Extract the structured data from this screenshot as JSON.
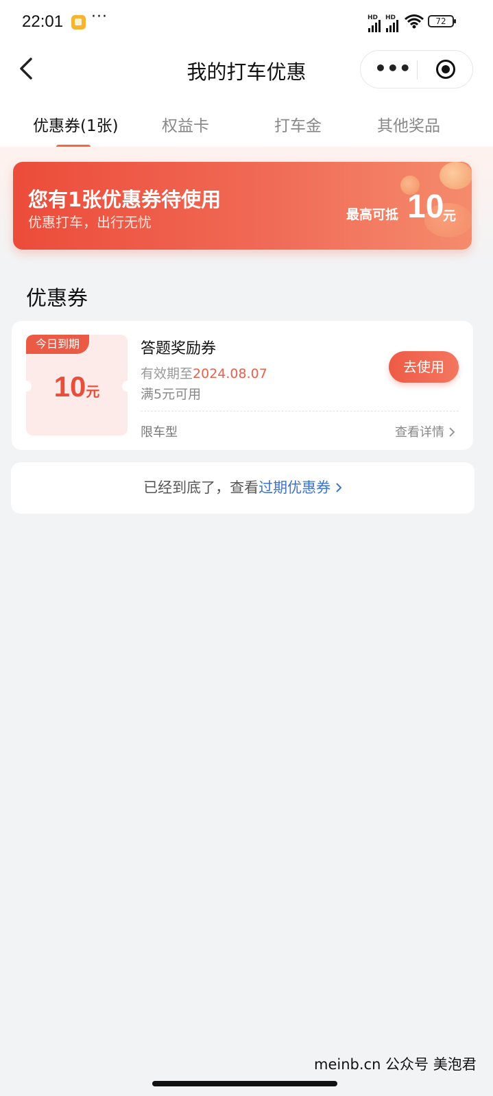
{
  "status_bar": {
    "time": "22:01",
    "more": "···",
    "battery": "72"
  },
  "header": {
    "title": "我的打车优惠",
    "menu_dots": "•••"
  },
  "tabs": [
    {
      "label": "优惠券(1张)",
      "active": true
    },
    {
      "label": "权益卡",
      "active": false
    },
    {
      "label": "打车金",
      "active": false
    },
    {
      "label": "其他奖品",
      "active": false
    }
  ],
  "banner": {
    "title": "您有1张优惠券待使用",
    "subtitle": "优惠打车，出行无忧",
    "max_label": "最高可抵",
    "max_amount": "10",
    "max_unit": "元"
  },
  "section": {
    "title": "优惠券"
  },
  "coupons": [
    {
      "tag": "今日到期",
      "amount": "10",
      "unit": "元",
      "name": "答题奖励券",
      "valid_prefix": "有效期至",
      "valid_date": "2024.08.07",
      "condition": "满5元可用",
      "button": "去使用",
      "limit": "限车型",
      "detail": "查看详情"
    }
  ],
  "footer_notice": {
    "text": "已经到底了，查看",
    "link": "过期优惠券"
  },
  "watermark": "meinb.cn  公众号 美泡君",
  "colors": {
    "accent": "#ea5a44",
    "link": "#3d73c9",
    "background": "#f2f3f5"
  }
}
